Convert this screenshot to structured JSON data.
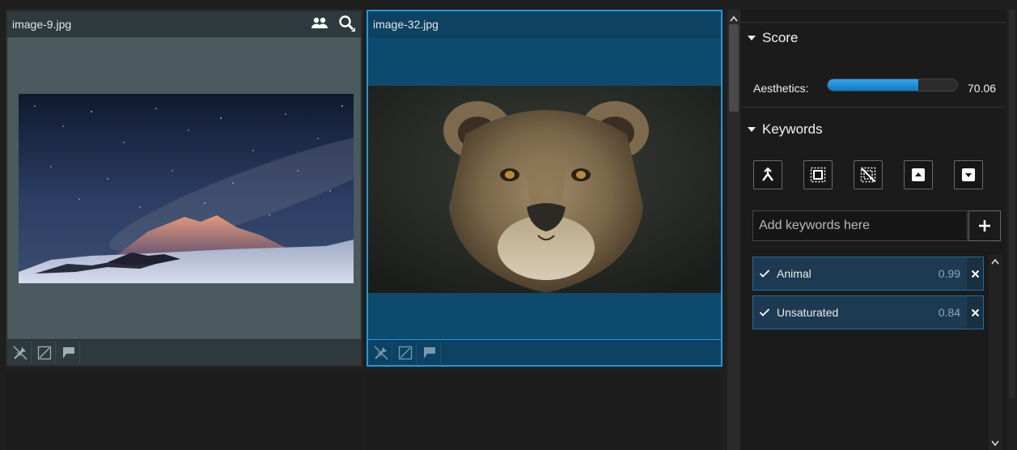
{
  "grid": {
    "cards": [
      {
        "filename": "image-9.jpg",
        "selected": false,
        "header_icons": [
          "people-icon",
          "search-icon"
        ],
        "footer_icons": [
          "unpin-icon",
          "reject-icon",
          "flag-icon"
        ]
      },
      {
        "filename": "image-32.jpg",
        "selected": true,
        "header_icons": [],
        "footer_icons": [
          "unpin-icon",
          "reject-icon",
          "flag-icon"
        ]
      }
    ]
  },
  "panel": {
    "score": {
      "title": "Score",
      "aesthetics_label": "Aesthetics:",
      "aesthetics_value": "70.06",
      "aesthetics_fraction": 0.7006
    },
    "keywords": {
      "title": "Keywords",
      "tools": [
        "split-icon",
        "select-all-icon",
        "deselect-all-icon",
        "upload-icon",
        "download-icon"
      ],
      "input_placeholder": "Add keywords here",
      "add_label": "+",
      "items": [
        {
          "name": "Animal",
          "score": "0.99"
        },
        {
          "name": "Unsaturated",
          "score": "0.84"
        }
      ]
    }
  },
  "colors": {
    "accent": "#1d9be0",
    "selected_card_bg": "#0e4a6e",
    "card_bg": "#4a5a5e",
    "panel_bg": "#1b1b1b"
  }
}
